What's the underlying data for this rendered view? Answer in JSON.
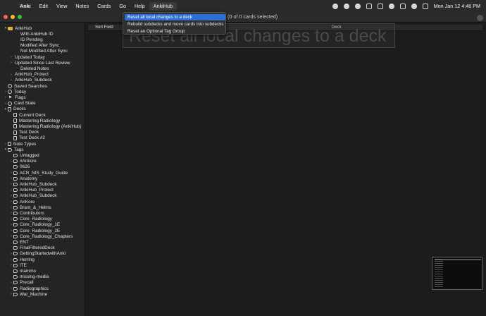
{
  "menubar": {
    "apple": "",
    "items": [
      "Anki",
      "Edit",
      "View",
      "Notes",
      "Cards",
      "Go",
      "Help",
      "AnkiHub"
    ],
    "clock": "Mon Jan 12  4:46 PM"
  },
  "window": {
    "selection_count": "(0 of 0 cards selected)"
  },
  "columns": {
    "sort_field": "Sort Field",
    "deck": "Deck"
  },
  "dropdown": {
    "items": [
      "Reset all local changes to a deck",
      "Rebuild subdecks and move cards into subdecks",
      "Reset an Optional Tag Group"
    ],
    "tooltip": "Reset all local changes to a deck"
  },
  "sidebar": {
    "rows": [
      {
        "label": "AnkiHub",
        "indent": 0,
        "caret": "▾",
        "icon": "folder"
      },
      {
        "label": "With AnkiHub ID",
        "indent": 2,
        "caret": "",
        "icon": ""
      },
      {
        "label": "ID Pending",
        "indent": 2,
        "caret": "",
        "icon": ""
      },
      {
        "label": "Modified After Sync",
        "indent": 2,
        "caret": "",
        "icon": ""
      },
      {
        "label": "Not Modified After Sync",
        "indent": 2,
        "caret": "",
        "icon": ""
      },
      {
        "label": "Updated Today",
        "indent": 1,
        "caret": "›",
        "icon": ""
      },
      {
        "label": "Updated Since Last Review",
        "indent": 1,
        "caret": "›",
        "icon": ""
      },
      {
        "label": "Deleted Notes",
        "indent": 2,
        "caret": "",
        "icon": ""
      },
      {
        "label": "AnkiHub_Protect",
        "indent": 1,
        "caret": "›",
        "icon": ""
      },
      {
        "label": "AnkiHub_Subdeck",
        "indent": 1,
        "caret": "›",
        "icon": ""
      },
      {
        "label": "Saved Searches",
        "indent": 0,
        "caret": "",
        "icon": "circle"
      },
      {
        "label": "Today",
        "indent": 0,
        "caret": "›",
        "icon": "circle"
      },
      {
        "label": "Flags",
        "indent": 0,
        "caret": "›",
        "icon": "flag"
      },
      {
        "label": "Card State",
        "indent": 0,
        "caret": "›",
        "icon": "circle"
      },
      {
        "label": "Decks",
        "indent": 0,
        "caret": "▾",
        "icon": "deck"
      },
      {
        "label": "Current Deck",
        "indent": 1,
        "caret": "",
        "icon": "deck"
      },
      {
        "label": "Mastering Radiology",
        "indent": 1,
        "caret": "",
        "icon": "deck"
      },
      {
        "label": "Mastering Radiology (AnkiHub)",
        "indent": 1,
        "caret": "",
        "icon": "deck"
      },
      {
        "label": "Test Deck",
        "indent": 1,
        "caret": "",
        "icon": "deck"
      },
      {
        "label": "Test Deck #2",
        "indent": 1,
        "caret": "",
        "icon": "deck"
      },
      {
        "label": "Note Types",
        "indent": 0,
        "caret": "›",
        "icon": "deck"
      },
      {
        "label": "Tags",
        "indent": 0,
        "caret": "▾",
        "icon": "tag"
      },
      {
        "label": "Untagged",
        "indent": 1,
        "caret": "",
        "icon": "tag"
      },
      {
        "label": "#Ankore",
        "indent": 1,
        "caret": "›",
        "icon": "tag"
      },
      {
        "label": "0626",
        "indent": 1,
        "caret": "",
        "icon": "tag"
      },
      {
        "label": "ACR_NIS_Study_Guide",
        "indent": 1,
        "caret": "›",
        "icon": "tag"
      },
      {
        "label": "Anatomy",
        "indent": 1,
        "caret": "›",
        "icon": "tag"
      },
      {
        "label": "AnkiHub_Subdeck",
        "indent": 1,
        "caret": "›",
        "icon": "tag"
      },
      {
        "label": "AnkiHub_Protect",
        "indent": 1,
        "caret": "›",
        "icon": "tag"
      },
      {
        "label": "AnkiHub_Subdeck",
        "indent": 1,
        "caret": "›",
        "icon": "tag"
      },
      {
        "label": "AnKore",
        "indent": 1,
        "caret": "›",
        "icon": "tag"
      },
      {
        "label": "Brant_&_Helms",
        "indent": 1,
        "caret": "›",
        "icon": "tag"
      },
      {
        "label": "Contributors",
        "indent": 1,
        "caret": "›",
        "icon": "tag"
      },
      {
        "label": "Core_Radiology",
        "indent": 1,
        "caret": "›",
        "icon": "tag"
      },
      {
        "label": "Core_Radiology_1E",
        "indent": 1,
        "caret": "›",
        "icon": "tag"
      },
      {
        "label": "Core_Radiology_2E",
        "indent": 1,
        "caret": "›",
        "icon": "tag"
      },
      {
        "label": "Core_Radiology_Chapters",
        "indent": 1,
        "caret": "›",
        "icon": "tag"
      },
      {
        "label": "ENT",
        "indent": 1,
        "caret": "",
        "icon": "tag"
      },
      {
        "label": "FinalFilteredDeck",
        "indent": 1,
        "caret": "",
        "icon": "tag"
      },
      {
        "label": "GettingStartedwithAnki",
        "indent": 1,
        "caret": "›",
        "icon": "tag"
      },
      {
        "label": "Herring",
        "indent": 1,
        "caret": "›",
        "icon": "tag"
      },
      {
        "label": "ITE",
        "indent": 1,
        "caret": "›",
        "icon": "tag"
      },
      {
        "label": "mammo",
        "indent": 1,
        "caret": "",
        "icon": "tag"
      },
      {
        "label": "missing-media",
        "indent": 1,
        "caret": "",
        "icon": "tag"
      },
      {
        "label": "Precall",
        "indent": 1,
        "caret": "›",
        "icon": "tag"
      },
      {
        "label": "Radiographics",
        "indent": 1,
        "caret": "›",
        "icon": "tag"
      },
      {
        "label": "War_Machine",
        "indent": 1,
        "caret": "›",
        "icon": "tag"
      }
    ]
  },
  "colors": {
    "traffic_red": "#ff5f57",
    "traffic_yellow": "#febc2e",
    "traffic_green": "#28c840",
    "highlight": "#2e6fd3"
  }
}
